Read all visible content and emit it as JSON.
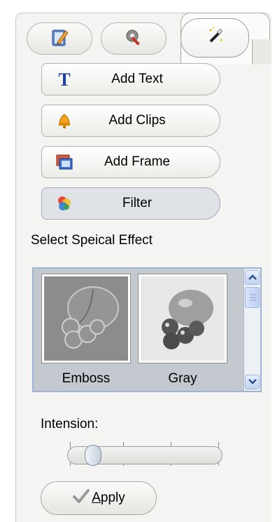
{
  "tabs": [
    {
      "icon": "pencil-edit-icon",
      "active": false
    },
    {
      "icon": "tools-icon",
      "active": false
    },
    {
      "icon": "magic-wand-icon",
      "active": true
    }
  ],
  "actions": [
    {
      "label": "Add Text",
      "icon": "text-t-icon",
      "selected": false
    },
    {
      "label": "Add Clips",
      "icon": "bell-clips-icon",
      "selected": false
    },
    {
      "label": "Add Frame",
      "icon": "frame-icon",
      "selected": false
    },
    {
      "label": "Filter",
      "icon": "color-filter-icon",
      "selected": true
    }
  ],
  "effects": {
    "section_label": "Select Speical Effect",
    "items": [
      {
        "label": "Emboss"
      },
      {
        "label": "Gray"
      }
    ]
  },
  "intensity": {
    "label": "Intension:",
    "value_fraction": 0.1
  },
  "apply_button": {
    "label_prefix": "",
    "label_underlined": "A",
    "label_rest": "pply"
  }
}
